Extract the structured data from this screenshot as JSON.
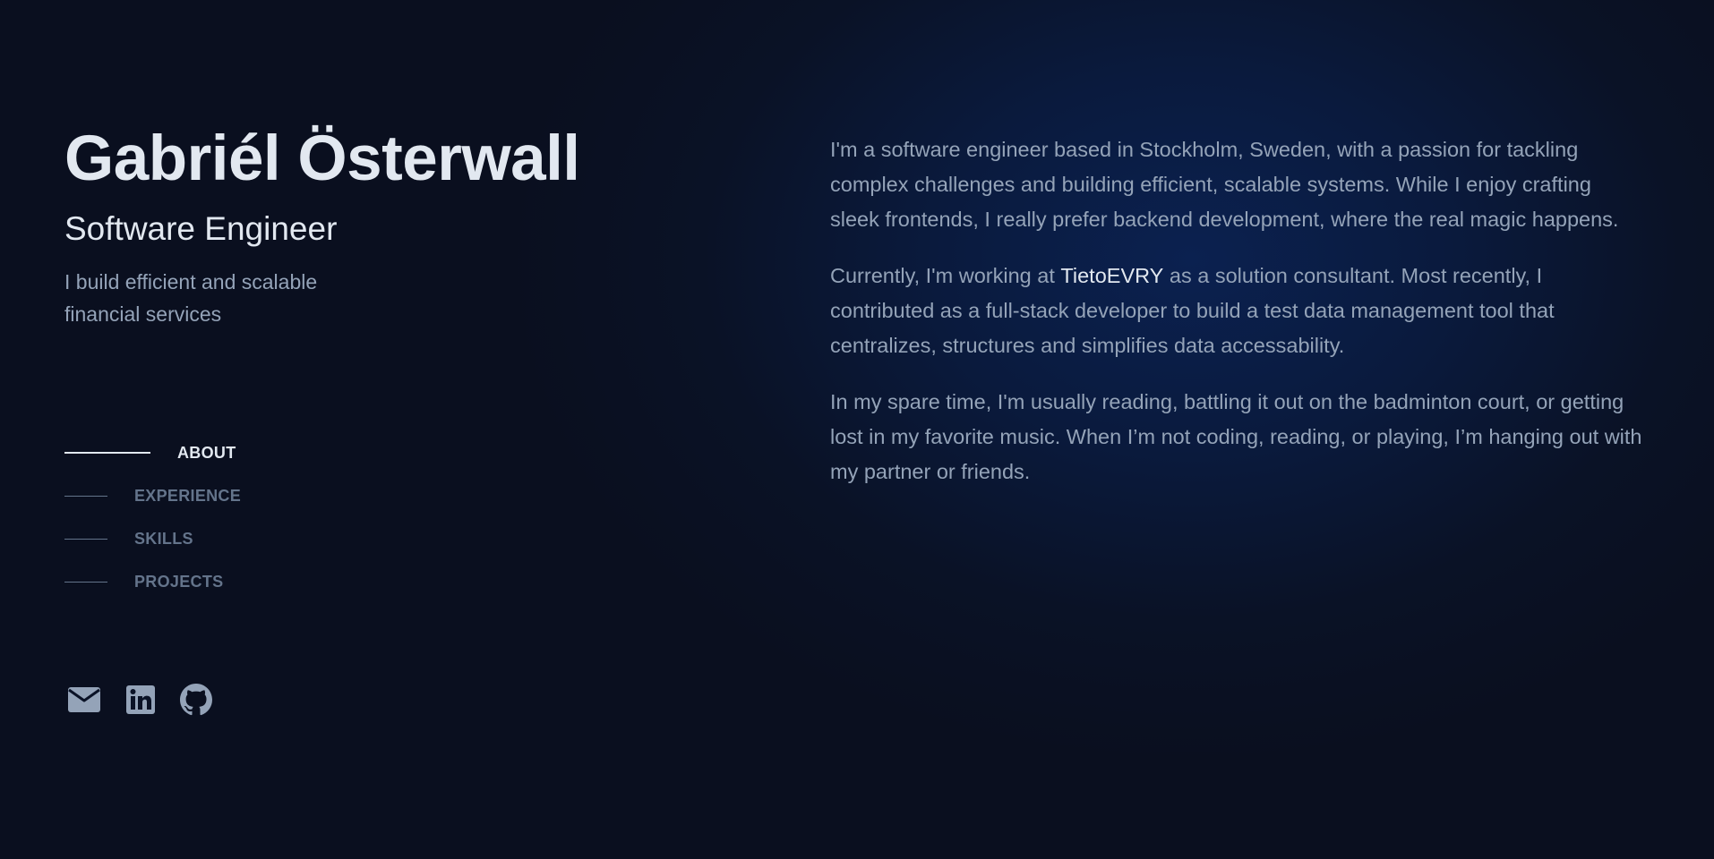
{
  "header": {
    "name": "Gabriél Österwall",
    "role": "Software Engineer",
    "tagline": "I build efficient and scalable financial services"
  },
  "nav": {
    "items": [
      {
        "label": "ABOUT",
        "active": true
      },
      {
        "label": "EXPERIENCE",
        "active": false
      },
      {
        "label": "SKILLS",
        "active": false
      },
      {
        "label": "PROJECTS",
        "active": false
      }
    ]
  },
  "socials": [
    {
      "icon": "mail-icon"
    },
    {
      "icon": "linkedin-icon"
    },
    {
      "icon": "github-icon"
    }
  ],
  "about": {
    "p1": "I'm a software engineer based in Stockholm, Sweden, with a passion for tackling complex challenges and building efficient, scalable systems. While I enjoy crafting sleek frontends, I really prefer backend development, where the real magic happens.",
    "p2_before": "Currently, I'm working at ",
    "p2_company": "TietoEVRY",
    "p2_after": " as a solution consultant. Most recently, I contributed as a full-stack developer to build a test data management tool that centralizes, structures and simplifies data accessability.",
    "p3": "In my spare time, I'm usually reading, battling it out on the badminton court, or getting lost in my favorite music. When I’m not coding, reading, or playing, I’m hanging out with my partner or friends."
  },
  "colors": {
    "background": "#0a1020",
    "heading": "#e2e8f0",
    "body_text": "#94a3b8",
    "muted": "#64748b"
  }
}
